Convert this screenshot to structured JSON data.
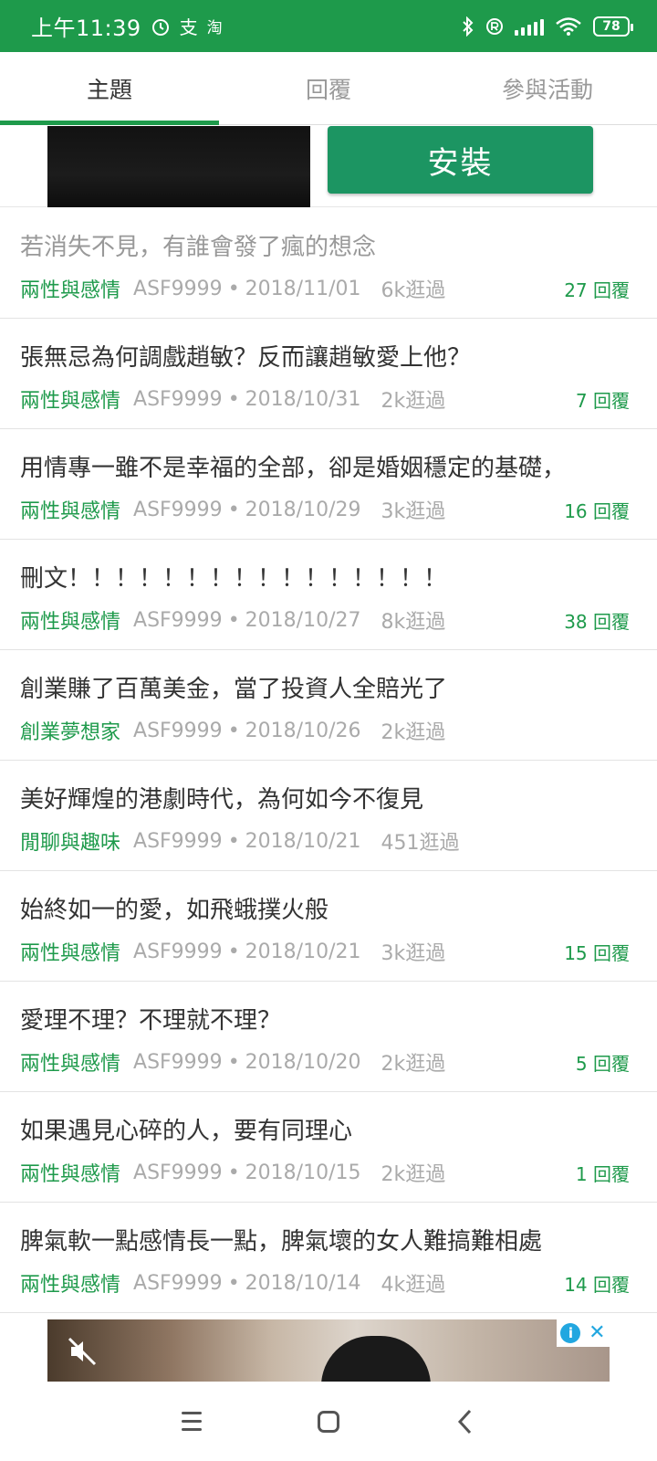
{
  "status_bar": {
    "time": "上午11:39",
    "app_icons": [
      "alarm-icon",
      "alipay-icon",
      "taobao-icon"
    ],
    "alipay_glyph": "支",
    "taobao_glyph": "淘",
    "battery": "78",
    "indicators": [
      "bluetooth-icon",
      "registered-icon",
      "signal-icon",
      "wifi-icon"
    ]
  },
  "tabs": [
    {
      "label": "主題",
      "active": true
    },
    {
      "label": "回覆",
      "active": false
    },
    {
      "label": "參與活動",
      "active": false
    }
  ],
  "ad_top": {
    "install_label": "安裝"
  },
  "posts": [
    {
      "title": "若消失不見，有誰會發了瘋的想念",
      "category": "兩性與感情",
      "author": "ASF9999",
      "date": "2018/11/01",
      "views": "6k逛過",
      "replies": "27 回覆",
      "read": true
    },
    {
      "title": "張無忌為何調戲趙敏？反而讓趙敏愛上他？",
      "category": "兩性與感情",
      "author": "ASF9999",
      "date": "2018/10/31",
      "views": "2k逛過",
      "replies": "7 回覆",
      "read": false
    },
    {
      "title": "用情專一雖不是幸福的全部，卻是婚姻穩定的基礎，",
      "category": "兩性與感情",
      "author": "ASF9999",
      "date": "2018/10/29",
      "views": "3k逛過",
      "replies": "16 回覆",
      "read": false
    },
    {
      "title": "刪文！！！！！！！！！！！！！！！！",
      "category": "兩性與感情",
      "author": "ASF9999",
      "date": "2018/10/27",
      "views": "8k逛過",
      "replies": "38 回覆",
      "read": false
    },
    {
      "title": "創業賺了百萬美金，當了投資人全賠光了",
      "category": "創業夢想家",
      "author": "ASF9999",
      "date": "2018/10/26",
      "views": "2k逛過",
      "replies": "",
      "read": false
    },
    {
      "title": "美好輝煌的港劇時代，為何如今不復見",
      "category": "閒聊與趣味",
      "author": "ASF9999",
      "date": "2018/10/21",
      "views": "451逛過",
      "replies": "",
      "read": false
    },
    {
      "title": "始終如一的愛，如飛蛾撲火般",
      "category": "兩性與感情",
      "author": "ASF9999",
      "date": "2018/10/21",
      "views": "3k逛過",
      "replies": "15 回覆",
      "read": false
    },
    {
      "title": "愛理不理？不理就不理？",
      "category": "兩性與感情",
      "author": "ASF9999",
      "date": "2018/10/20",
      "views": "2k逛過",
      "replies": "5 回覆",
      "read": false
    },
    {
      "title": "如果遇見心碎的人，要有同理心",
      "category": "兩性與感情",
      "author": "ASF9999",
      "date": "2018/10/15",
      "views": "2k逛過",
      "replies": "1 回覆",
      "read": false
    },
    {
      "title": "脾氣軟一點感情長一點，脾氣壞的女人難搞難相處",
      "category": "兩性與感情",
      "author": "ASF9999",
      "date": "2018/10/14",
      "views": "4k逛過",
      "replies": "14 回覆",
      "read": false
    }
  ],
  "ad_bottom": {
    "icons": [
      "mute-icon",
      "ad-info-icon",
      "ad-close-icon"
    ],
    "info_glyph": "i",
    "close_glyph": "✕"
  },
  "nav_bar": {
    "buttons": [
      "menu-icon",
      "home-icon",
      "back-icon"
    ]
  },
  "colors": {
    "accent": "#1e9a4b",
    "install_button": "#1c9562"
  }
}
